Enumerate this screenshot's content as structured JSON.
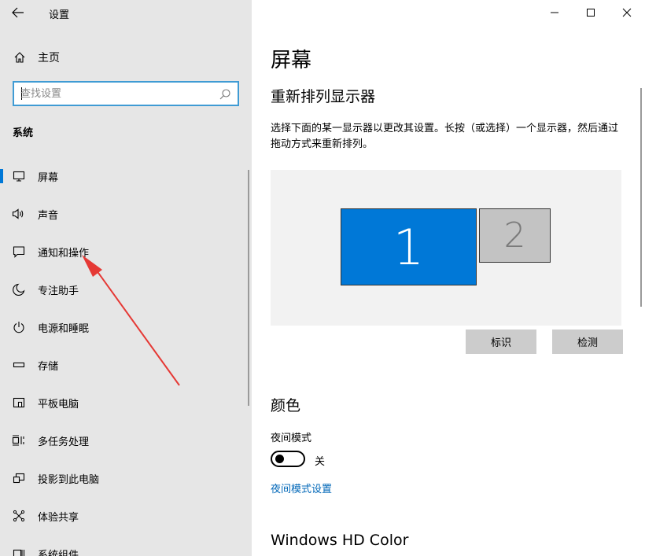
{
  "window": {
    "title": "设置",
    "controls": [
      "minimize-icon",
      "maximize-icon",
      "close-icon"
    ]
  },
  "sidebar": {
    "home_label": "主页",
    "search": {
      "placeholder": "查找设置",
      "value": ""
    },
    "section_label": "系统",
    "items": [
      {
        "label": "屏幕",
        "icon": "monitor-icon",
        "active": true
      },
      {
        "label": "声音",
        "icon": "speaker-icon",
        "active": false
      },
      {
        "label": "通知和操作",
        "icon": "notification-icon",
        "active": false
      },
      {
        "label": "专注助手",
        "icon": "moon-icon",
        "active": false
      },
      {
        "label": "电源和睡眠",
        "icon": "power-icon",
        "active": false
      },
      {
        "label": "存储",
        "icon": "storage-icon",
        "active": false
      },
      {
        "label": "平板电脑",
        "icon": "tablet-icon",
        "active": false
      },
      {
        "label": "多任务处理",
        "icon": "multitask-icon",
        "active": false
      },
      {
        "label": "投影到此电脑",
        "icon": "project-icon",
        "active": false
      },
      {
        "label": "体验共享",
        "icon": "share-icon",
        "active": false
      },
      {
        "label": "系统组件",
        "icon": "components-icon",
        "active": false
      }
    ]
  },
  "main": {
    "page_title": "屏幕",
    "rearrange": {
      "heading": "重新排列显示器",
      "description": "选择下面的某一显示器以更改其设置。长按（或选择）一个显示器，然后通过拖动方式来重新排列。",
      "monitors": [
        {
          "label": "1",
          "selected": true
        },
        {
          "label": "2",
          "selected": false
        }
      ],
      "identify_button": "标识",
      "detect_button": "检测"
    },
    "color": {
      "heading": "颜色",
      "night_light_label": "夜间模式",
      "night_light_state": "关",
      "night_light_on": false,
      "night_light_link": "夜间模式设置"
    },
    "hdr_heading": "Windows HD Color"
  },
  "colors": {
    "accent": "#0078d7",
    "sidebar_bg": "#e6e6e6",
    "link": "#0067b8",
    "annotation_arrow": "#e53935"
  }
}
